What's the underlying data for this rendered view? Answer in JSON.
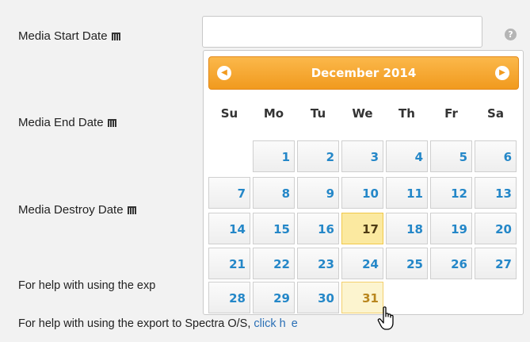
{
  "fields": {
    "start_label": "Media Start Date",
    "end_label": "Media End Date",
    "destroy_label": "Media Destroy Date",
    "help_icon": "?"
  },
  "help": {
    "line1": "For help with using the exp",
    "line2_prefix": "For help with using the export to Spectra O/S, ",
    "line2_link": "click h",
    "line2_tail": "e"
  },
  "datepicker": {
    "title": "December 2014",
    "prev_icon": "chevron-left-icon",
    "next_icon": "chevron-right-icon",
    "weekdays": [
      "Su",
      "Mo",
      "Tu",
      "We",
      "Th",
      "Fr",
      "Sa"
    ],
    "weeks": [
      [
        null,
        "1",
        "2",
        "3",
        "4",
        "5",
        "6"
      ],
      [
        "7",
        "8",
        "9",
        "10",
        "11",
        "12",
        "13"
      ],
      [
        "14",
        "15",
        "16",
        "17",
        "18",
        "19",
        "20"
      ],
      [
        "21",
        "22",
        "23",
        "24",
        "25",
        "26",
        "27"
      ],
      [
        "28",
        "29",
        "30",
        "31",
        null,
        null,
        null
      ]
    ],
    "today": "17",
    "selected": "31",
    "header_color": "#f19a1e",
    "day_text_color": "#2487c8"
  }
}
